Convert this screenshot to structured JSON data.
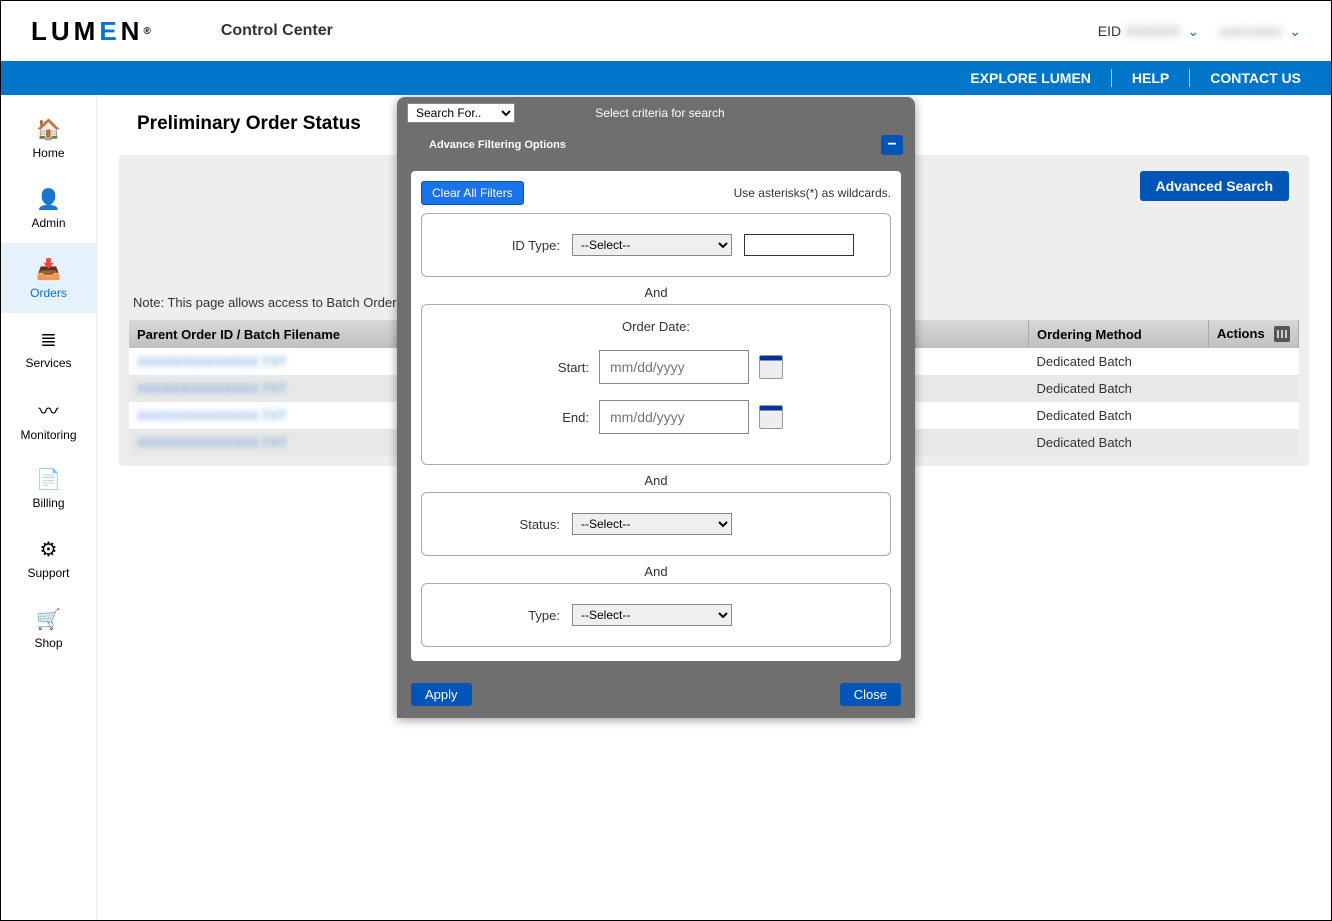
{
  "header": {
    "logo_text": "LUM",
    "logo_e": "E",
    "logo_rest": "N",
    "logo_tm": "®",
    "app_name": "Control Center",
    "eid_label": "EID",
    "eid_value": "0000000",
    "username": "username"
  },
  "topnav": {
    "explore": "EXPLORE LUMEN",
    "help": "HELP",
    "contact": "CONTACT US"
  },
  "sidebar": {
    "items": [
      {
        "label": "Home",
        "icon": "🏠"
      },
      {
        "label": "Admin",
        "icon": "👤"
      },
      {
        "label": "Orders",
        "icon": "📥"
      },
      {
        "label": "Services",
        "icon": "≣"
      },
      {
        "label": "Monitoring",
        "icon": "〰"
      },
      {
        "label": "Billing",
        "icon": "📄"
      },
      {
        "label": "Support",
        "icon": "⚙"
      },
      {
        "label": "Shop",
        "icon": "🛒"
      }
    ]
  },
  "page": {
    "title": "Preliminary Order Status",
    "adv_search": "Advanced Search",
    "note": "Note: This page allows access to Batch Order Status and de",
    "columns": {
      "c1": "Parent Order ID / Batch Filename",
      "c2": "Ordering Method",
      "c3": "Actions"
    },
    "rows": [
      {
        "id": "XXXXXXXXXXXXXX.TXT",
        "method": "Dedicated Batch"
      },
      {
        "id": "XXXXXXXXXXXXXX.TXT",
        "method": "Dedicated Batch"
      },
      {
        "id": "XXXXXXXXXXXXXX.TXT",
        "method": "Dedicated Batch"
      },
      {
        "id": "XXXXXXXXXXXXXX.TXT",
        "method": "Dedicated Batch"
      }
    ]
  },
  "modal": {
    "search_for_placeholder": "Search For..",
    "top_text": "Select criteria for search",
    "title": "Advance Filtering Options",
    "clear_all": "Clear All Filters",
    "wildcard": "Use asterisks(*) as wildcards.",
    "id_type_label": "ID Type:",
    "select_opt": "--Select--",
    "and": "And",
    "order_date_label": "Order Date:",
    "start_label": "Start:",
    "end_label": "End:",
    "date_placeholder": "mm/dd/yyyy",
    "status_label": "Status:",
    "type_label": "Type:",
    "apply": "Apply",
    "close": "Close"
  }
}
